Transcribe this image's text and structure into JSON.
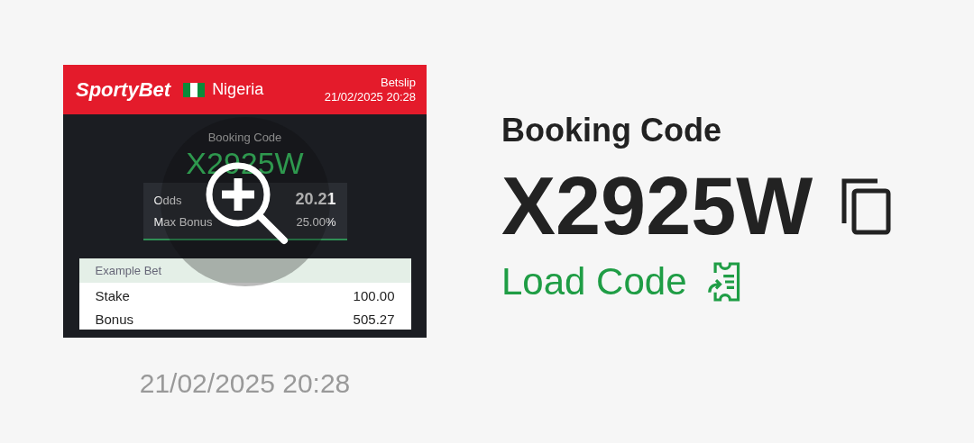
{
  "thumbnail": {
    "brand": "SportyBet",
    "country": "Nigeria",
    "slip_label": "Betslip",
    "slip_time": "21/02/2025 20:28",
    "code_label": "Booking Code",
    "code": "X2925W",
    "stats": [
      {
        "label": "Odds",
        "value": "20.21"
      },
      {
        "label": "Max Bonus",
        "value": "25.00%"
      }
    ],
    "example_title": "Example Bet",
    "example_rows": [
      {
        "label": "Stake",
        "value": "100.00"
      },
      {
        "label": "Bonus",
        "value": "505.27"
      }
    ]
  },
  "date": "21/02/2025 20:28",
  "heading": "Booking Code",
  "code": "X2925W",
  "load_button": "Load Code"
}
